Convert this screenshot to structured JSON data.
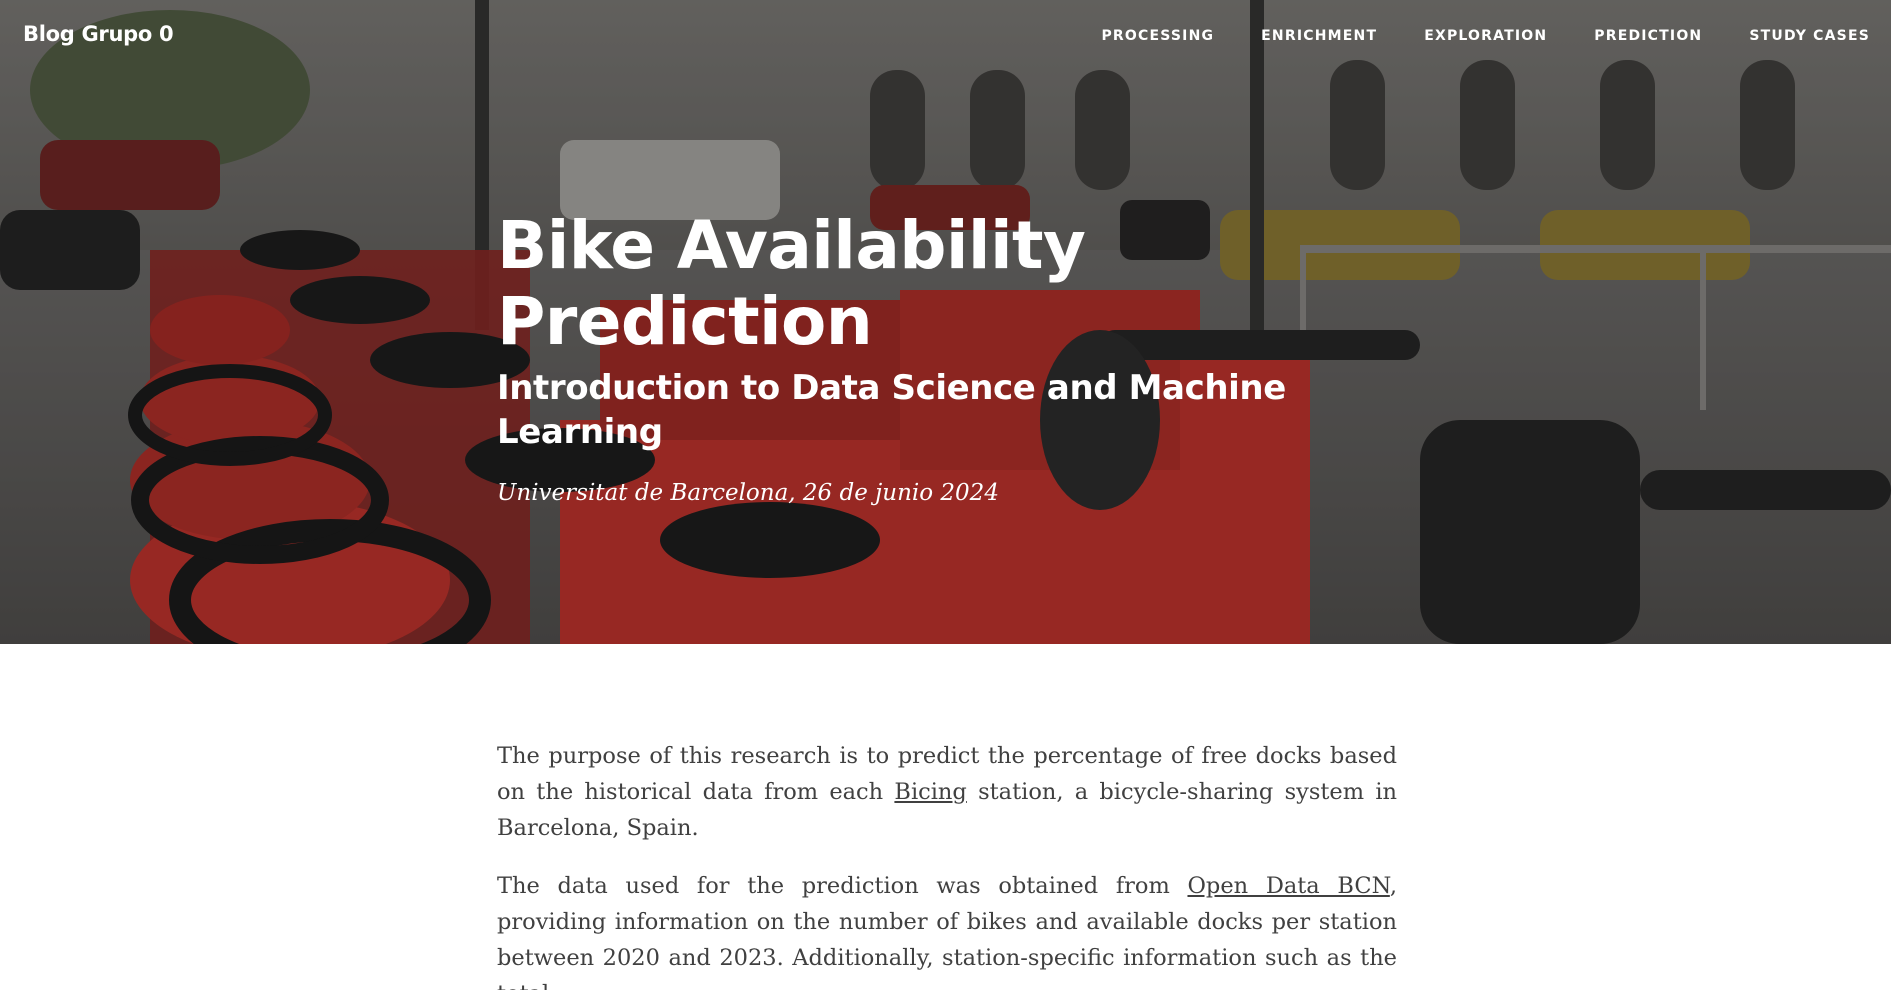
{
  "navbar": {
    "brand": "Blog Grupo 0",
    "links": [
      "PROCESSING",
      "ENRICHMENT",
      "EXPLORATION",
      "PREDICTION",
      "STUDY CASES"
    ]
  },
  "header": {
    "title": "Bike Availability Prediction",
    "subtitle": "Introduction to Data Science and Machine Learning",
    "meta": "Universitat de Barcelona, 26 de junio 2024"
  },
  "article": {
    "p1": {
      "before": "The purpose of this research is to predict the percentage of free docks based on the historical data from each ",
      "link": "Bicing",
      "after": " station, a bicycle-sharing system in Barcelona, Spain."
    },
    "p2": {
      "before": "The data used for the prediction was obtained from ",
      "link": "Open Data BCN",
      "after": ", providing information on the number of bikes and available docks per station between 2020 and 2023. Additionally, station-specific information such as the total"
    }
  },
  "colors": {
    "bike_red": "#d83a33",
    "text": "#404040",
    "overlay": "#000000"
  }
}
